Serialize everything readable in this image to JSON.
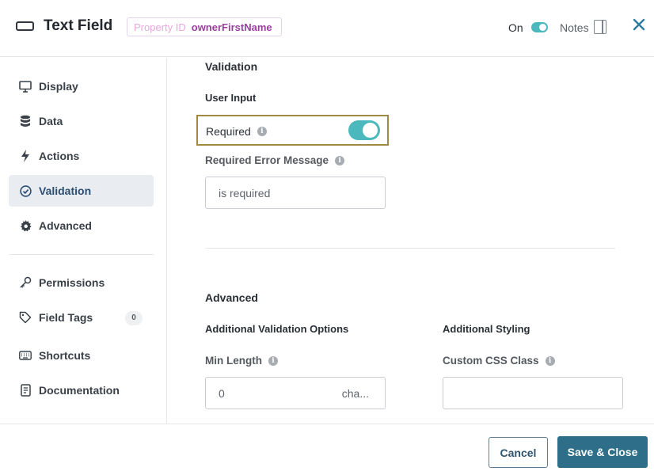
{
  "header": {
    "title": "Text Field",
    "property_id_label": "Property ID",
    "property_id_value": "ownerFirstName",
    "on_label": "On",
    "on_toggle_state": true,
    "notes_label": "Notes",
    "close_icon": "close-icon"
  },
  "sidebar": {
    "items": [
      {
        "label": "Display",
        "icon": "monitor-icon"
      },
      {
        "label": "Data",
        "icon": "database-icon"
      },
      {
        "label": "Actions",
        "icon": "lightning-icon"
      },
      {
        "label": "Validation",
        "icon": "check-circle-icon",
        "active": true
      },
      {
        "label": "Advanced",
        "icon": "gear-icon"
      },
      {
        "label": "Permissions",
        "icon": "key-icon"
      },
      {
        "label": "Field Tags",
        "icon": "tag-icon",
        "count": "0"
      },
      {
        "label": "Shortcuts",
        "icon": "keyboard-icon"
      },
      {
        "label": "Documentation",
        "icon": "document-icon"
      }
    ]
  },
  "validation": {
    "title": "Validation",
    "user_input_title": "User Input",
    "required_label": "Required",
    "required_state": true,
    "error_message_label": "Required Error Message",
    "error_message_value": "is required"
  },
  "advanced": {
    "title": "Advanced",
    "options_title": "Additional Validation Options",
    "styling_title": "Additional Styling",
    "min_length_label": "Min Length",
    "min_length_value": "0",
    "min_length_suffix": "cha...",
    "css_class_label": "Custom CSS Class",
    "css_class_value": ""
  },
  "footer": {
    "cancel_label": "Cancel",
    "save_label": "Save & Close"
  },
  "colors": {
    "toggle_on": "#4bb8bd",
    "primary_button": "#2e6e88",
    "active_nav_bg": "#e9edf1",
    "highlight_border": "#a08a42",
    "property_badge_text": "#9b3fa0"
  }
}
